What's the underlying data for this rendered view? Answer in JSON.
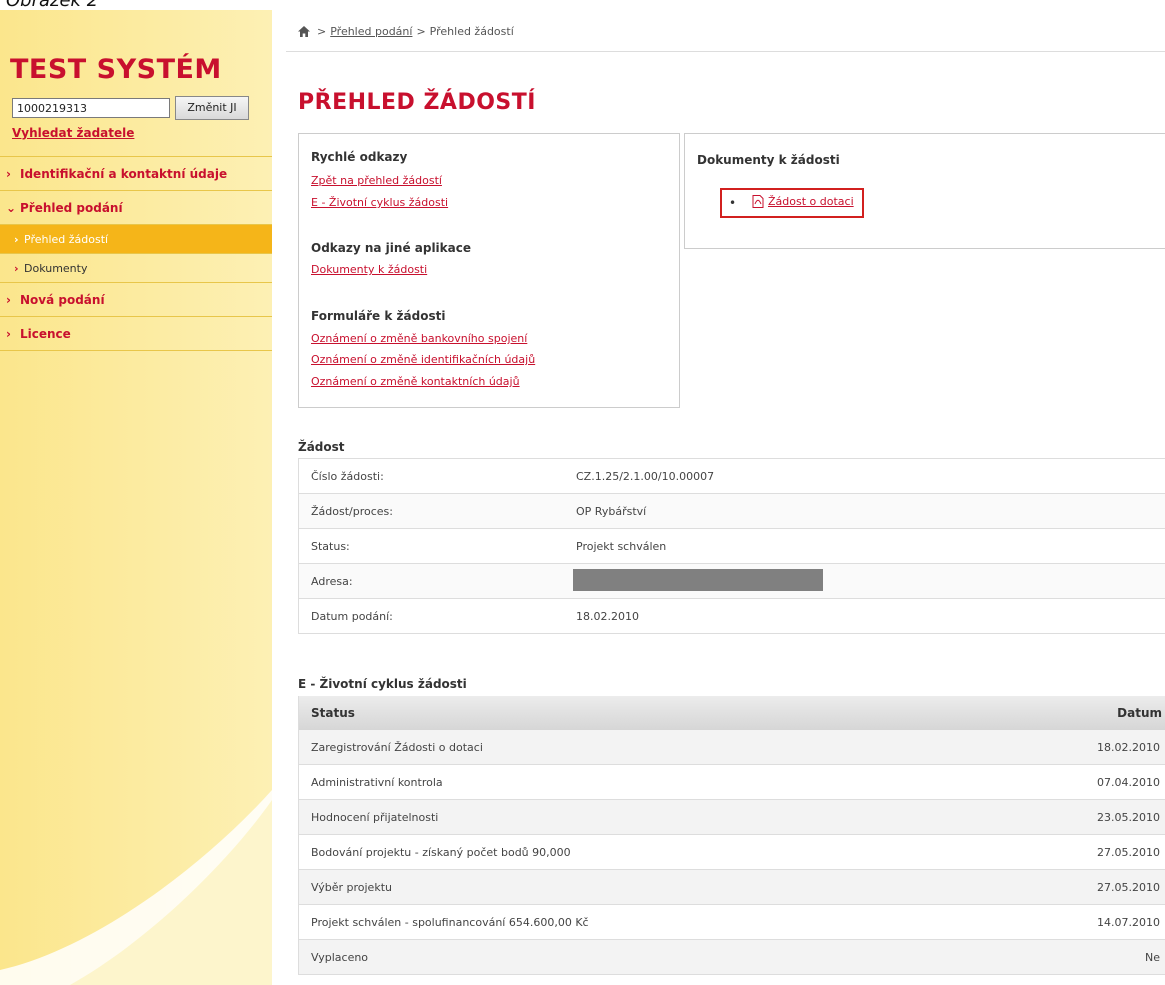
{
  "caption": "Obrázek 2",
  "sidebar": {
    "app_title": "TEST SYSTÉM",
    "ji_value": "1000219313",
    "ji_button": "Změnit JI",
    "search_link": "Vyhledat žadatele",
    "menu": {
      "identification": "Identifikační a kontaktní údaje",
      "overview": "Přehled podání",
      "overview_requests": "Přehled žádostí",
      "documents": "Dokumenty",
      "new_submissions": "Nová podání",
      "licences": "Licence"
    }
  },
  "breadcrumb": {
    "item1": "Přehled podání",
    "separator": ">",
    "item2": "Přehled žádostí"
  },
  "page_title": "PŘEHLED ŽÁDOSTÍ",
  "quick_links": {
    "heading": "Rychlé odkazy",
    "back": "Zpět na přehled žádostí",
    "lifecycle": "E - Životní cyklus žádosti",
    "other_apps_heading": "Odkazy na jiné aplikace",
    "docs_link": "Dokumenty k žádosti",
    "forms_heading": "Formuláře k žádosti",
    "form_bank": "Oznámení o změně bankovního spojení",
    "form_ident": "Oznámení o změně identifikačních údajů",
    "form_contact": "Oznámení o změně kontaktních údajů"
  },
  "documents": {
    "heading": "Dokumenty k žádosti",
    "item": "Žádost o dotaci",
    "icon": "pdf-icon"
  },
  "request": {
    "heading": "Žádost",
    "rows": [
      {
        "label": "Číslo žádosti:",
        "value": "CZ.1.25/2.1.00/10.00007"
      },
      {
        "label": "Žádost/proces:",
        "value": "OP Rybářství"
      },
      {
        "label": "Status:",
        "value": "Projekt schválen"
      },
      {
        "label": "Adresa:",
        "value": ""
      },
      {
        "label": "Datum podání:",
        "value": "18.02.2010"
      }
    ]
  },
  "lifecycle": {
    "heading": "E - Životní cyklus žádosti",
    "col_status": "Status",
    "col_date": "Datum",
    "rows": [
      {
        "status": "Zaregistrování Žádosti o dotaci",
        "date": "18.02.2010"
      },
      {
        "status": "Administrativní kontrola",
        "date": "07.04.2010"
      },
      {
        "status": "Hodnocení přijatelnosti",
        "date": "23.05.2010"
      },
      {
        "status": "Bodování projektu - získaný počet bodů 90,000",
        "date": "27.05.2010"
      },
      {
        "status": "Výběr projektu",
        "date": "27.05.2010"
      },
      {
        "status": "Projekt schválen - spolufinancování 654.600,00 Kč",
        "date": "14.07.2010"
      },
      {
        "status": "Vyplaceno",
        "date": "Ne"
      }
    ]
  },
  "colors": {
    "accent": "#c8102e",
    "sidebar": "#fbe68c",
    "active_menu": "#f5b519",
    "highlight_border": "#d2201f"
  }
}
